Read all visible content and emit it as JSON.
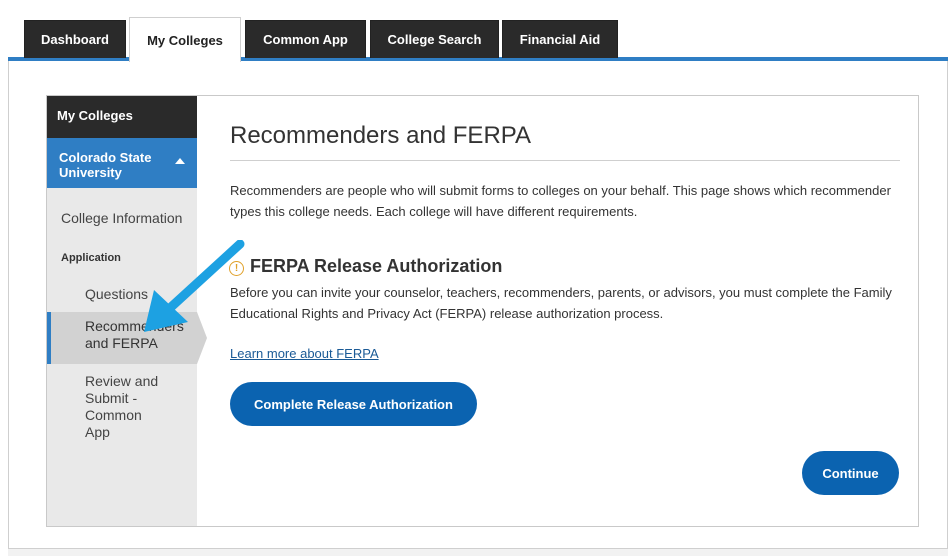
{
  "tabs": [
    {
      "label": "Dashboard",
      "active": false
    },
    {
      "label": "My Colleges",
      "active": true
    },
    {
      "label": "Common App",
      "active": false
    },
    {
      "label": "College Search",
      "active": false
    },
    {
      "label": "Financial Aid",
      "active": false
    }
  ],
  "sidebar": {
    "header": "My Colleges",
    "college": "Colorado State University",
    "college_information": "College Information",
    "application_section": "Application",
    "questions": "Questions",
    "recommenders": "Recommenders and FERPA",
    "review": "Review and Submit - Common App"
  },
  "main": {
    "title": "Recommenders and FERPA",
    "intro": "Recommenders are people who will submit forms to colleges on your behalf. This page shows which recommender types this college needs. Each college will have different requirements.",
    "ferpa_title": "FERPA Release Authorization",
    "ferpa_body": "Before you can invite your counselor, teachers, recommenders, parents, or advisors, you must complete the Family Educational Rights and Privacy Act (FERPA) release authorization process.",
    "learn_more": "Learn more about FERPA",
    "release_button": "Complete Release Authorization",
    "continue_button": "Continue"
  },
  "colors": {
    "accent": "#2f7ec4",
    "button": "#0b63b0",
    "arrow": "#1da1e2",
    "warning": "#e0a12a",
    "tab_dark": "#2a2a2a"
  },
  "icons": {
    "warning": "warning-circle-icon",
    "collapse": "chevron-up-icon",
    "annotation": "annotation-arrow-icon"
  }
}
